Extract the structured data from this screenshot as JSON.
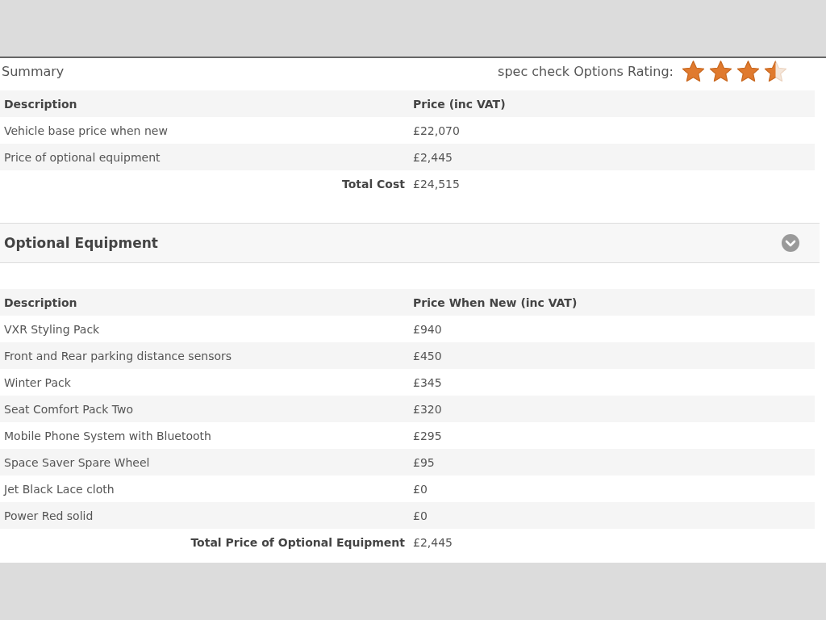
{
  "summary": {
    "title": "Summary",
    "rating_label": "spec check Options Rating:",
    "stars": 3.5,
    "columns": [
      "Description",
      "Price (inc VAT)"
    ],
    "rows": [
      {
        "description": "Vehicle base price when new",
        "price": "£22,070"
      },
      {
        "description": "Price of optional equipment",
        "price": "£2,445"
      }
    ],
    "total": {
      "label": "Total Cost",
      "value": "£24,515"
    }
  },
  "optional_equipment": {
    "title": "Optional Equipment",
    "expanded": true,
    "columns": [
      "Description",
      "Price When New (inc VAT)"
    ],
    "rows": [
      {
        "description": "VXR Styling Pack",
        "price": "£940"
      },
      {
        "description": "Front and Rear parking distance sensors",
        "price": "£450"
      },
      {
        "description": "Winter Pack",
        "price": "£345"
      },
      {
        "description": "Seat Comfort Pack Two",
        "price": "£320"
      },
      {
        "description": "Mobile Phone System with Bluetooth",
        "price": "£295"
      },
      {
        "description": "Space Saver Spare Wheel",
        "price": "£95"
      },
      {
        "description": "Jet Black Lace cloth",
        "price": "£0"
      },
      {
        "description": "Power Red solid",
        "price": "£0"
      }
    ],
    "total": {
      "label": "Total Price of Optional Equipment",
      "value": "£2,445"
    }
  }
}
